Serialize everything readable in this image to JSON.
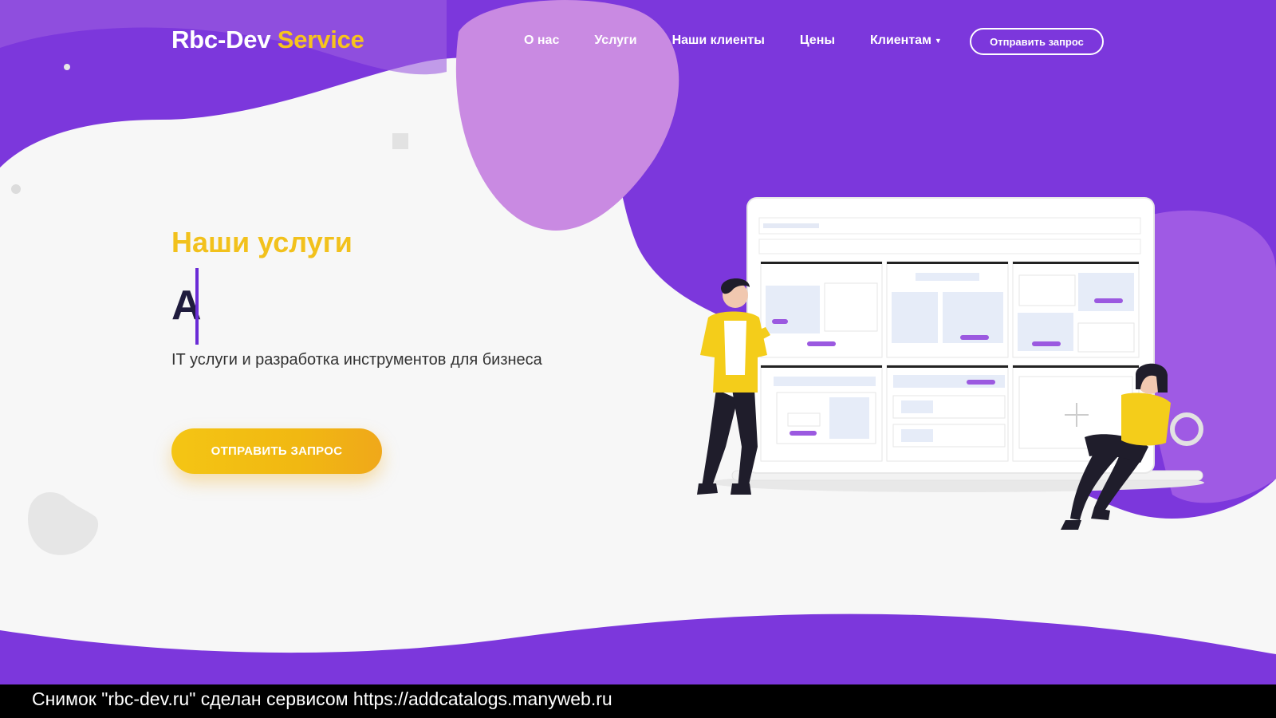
{
  "header": {
    "logo_main": "Rbc-Dev",
    "logo_accent": "Service",
    "nav": [
      "О нас",
      "Услуги",
      "Наши клиенты",
      "Цены",
      "Клиентам"
    ],
    "nav_dropdown_icon": "caret-down-icon",
    "cta_label": "Отправить запрос"
  },
  "hero": {
    "title": "Наши услуги",
    "typed_text": "A",
    "subtitle": "IT услуги и разработка инструментов для бизнеса",
    "cta_label": "ОТПРАВИТЬ ЗАПРОС"
  },
  "footer": {
    "caption": "Снимок \"rbc-dev.ru\" сделан сервисом https://addcatalogs.manyweb.ru"
  },
  "colors": {
    "purple": "#7a36dc",
    "light_purple": "#c88be0",
    "yellow": "#f4c514",
    "dark_text": "#1f1b3d",
    "background": "#f7f7f7"
  }
}
